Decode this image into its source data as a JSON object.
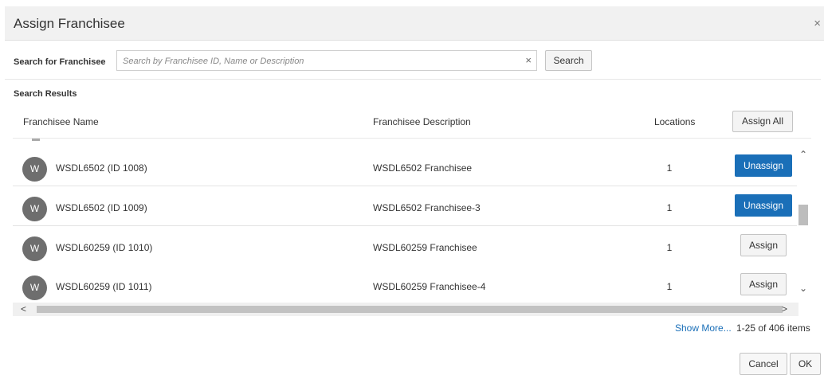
{
  "dialog": {
    "title": "Assign Franchisee",
    "close_icon": "×"
  },
  "search": {
    "label": "Search for Franchisee",
    "placeholder": "Search by Franchisee ID, Name or Description",
    "value": "",
    "clear_icon": "×",
    "button_label": "Search"
  },
  "results": {
    "label": "Search Results",
    "columns": {
      "name": "Franchisee Name",
      "description": "Franchisee Description",
      "locations": "Locations"
    },
    "assign_all_label": "Assign All",
    "rows": [
      {
        "avatar": "W",
        "name": "WSDL6502  (ID 1008)",
        "description": "WSDL6502 Franchisee",
        "locations": "1",
        "action": "Unassign"
      },
      {
        "avatar": "W",
        "name": "WSDL6502  (ID 1009)",
        "description": "WSDL6502  Franchisee-3",
        "locations": "1",
        "action": "Unassign"
      },
      {
        "avatar": "W",
        "name": "WSDL60259  (ID 1010)",
        "description": "WSDL60259 Franchisee",
        "locations": "1",
        "action": "Assign"
      },
      {
        "avatar": "W",
        "name": "WSDL60259  (ID 1011)",
        "description": "WSDL60259 Franchisee-4",
        "locations": "1",
        "action": "Assign"
      }
    ]
  },
  "scroll": {
    "up_icon": "⌃",
    "down_icon": "⌄",
    "left_icon": "<",
    "right_icon": ">"
  },
  "footer": {
    "show_more_label": "Show More...",
    "count_text": "1-25 of 406 items",
    "cancel_label": "Cancel",
    "ok_label": "OK"
  },
  "colors": {
    "primary": "#1a6fb8",
    "avatar": "#6e6e6e"
  }
}
